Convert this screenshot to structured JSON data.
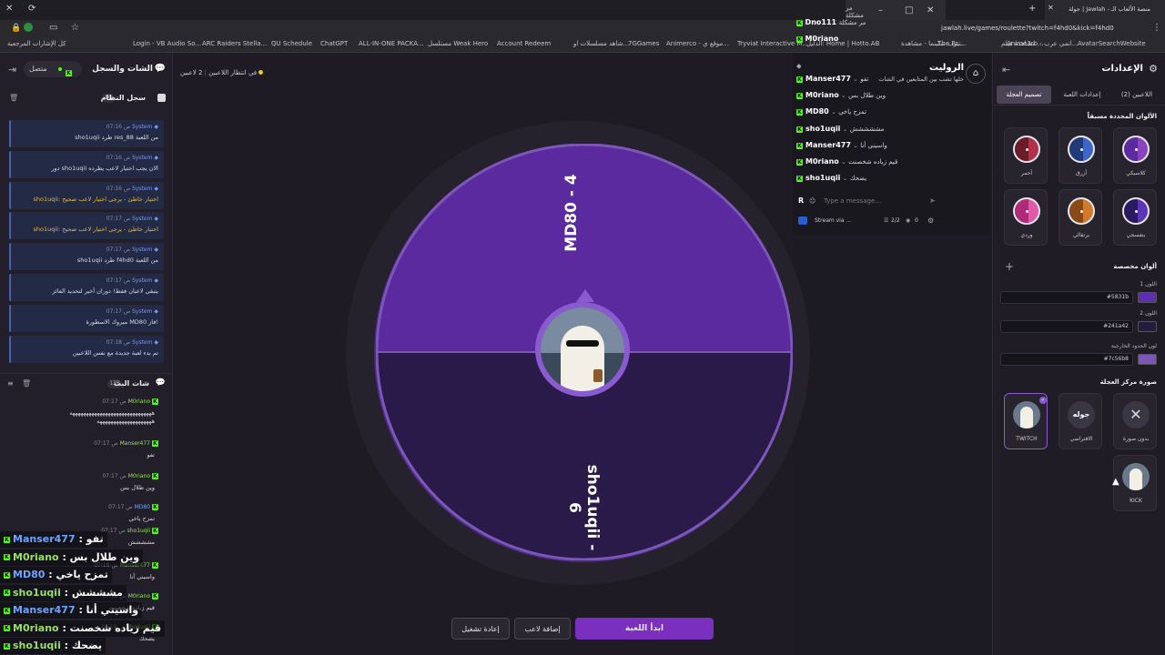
{
  "browser": {
    "tabs": [
      "مر مشكلة",
      "جولة | Jawlah - منصة الألعاب الـ"
    ],
    "url": "jawlah.live/games/roulette?twitch=f4hd0&kick=f4hd0",
    "bookmarks": [
      "كل الإشارات المرجعية",
      "Login - VB Audio So...",
      "ARC Raiders Stella...",
      "QU Schedule",
      "ChatGPT",
      "ALL-IN-ONE PACKA...",
      "مستلسل Weak Hero",
      "Account Redeem",
      "شاهد مسلسلات او...",
      "7GGames",
      "Animerco - موقع ي...",
      "Tryviat Interactive M...",
      "The Br...",
      "مشاهدة فيلم ...",
      "تيرب سلينما - مشاهدة...",
      "الدليل: Home | Hotto.AB",
      "Anime3rb - انمي عرب...",
      "AvatarSearchWebsite"
    ]
  },
  "left_panel": {
    "title": "الشات والسجل",
    "status": "متصل",
    "system_log": {
      "title": "سجل النظام",
      "count": "80",
      "entries": [
        {
          "time": "07:16 ص",
          "name": "System",
          "text": "sho1uqii طرد res_88 من اللعبة",
          "warn": false
        },
        {
          "time": "07:16 ص",
          "name": "System",
          "text": "دور sho1uqii الان يجب اختيار لاعب يطرده",
          "warn": false
        },
        {
          "time": "07:16 ص",
          "name": "System",
          "text": "sho1uqii: اختيار خاطئ - يرجى اختيار لاعب صحيح",
          "warn": true
        },
        {
          "time": "07:17 ص",
          "name": "System",
          "text": "sho1uqii: اختيار خاطئ - يرجى اختيار لاعب صحيح",
          "warn": true
        },
        {
          "time": "07:17 ص",
          "name": "System",
          "text": "sho1uqii طرد f4hd0 من اللعبة",
          "warn": false
        },
        {
          "time": "07:17 ص",
          "name": "System",
          "text": "يتبقى لاعبان فقط! دوران أخير لتحديد الفائز",
          "warn": false
        },
        {
          "time": "07:17 ص",
          "name": "System",
          "text": "مبروك الاسطورة MD80 فاز!",
          "warn": false
        },
        {
          "time": "07:18 ص",
          "name": "System",
          "text": "تم بدء لعبة جديدة مع نفس اللاعبين",
          "warn": false
        }
      ]
    },
    "stream_chat": {
      "title": "شات البث",
      "count": "133",
      "messages": [
        {
          "time": "07:17 ص",
          "name": "M0riano",
          "text": "ههههههههههههههههههههههههههههههه",
          "text2": "ههههههههههههههههههههه"
        },
        {
          "time": "07:17 ص",
          "name": "Manser477",
          "text": "تفو"
        },
        {
          "time": "07:17 ص",
          "name": "M0riano",
          "text": "وين طلال بس"
        },
        {
          "time": "07:17 ص",
          "name": "MD80",
          "text": "تمزح ياخي"
        },
        {
          "time": "07:17 ص",
          "name": "sho1uqii",
          "text": "مشششش"
        },
        {
          "time": "07:18 ص",
          "name": "Manser477",
          "text": "واسيني أنا"
        },
        {
          "time": "07:18 ص",
          "name": "M0riano",
          "text": "قيم زياده شخصنت"
        },
        {
          "time": "07:18 ص",
          "name": "sho1uqii",
          "text": "يضحك"
        }
      ]
    },
    "overlay": [
      {
        "name": "Manser477",
        "text": "تفو"
      },
      {
        "name": "M0riano",
        "text": "وين طلال بس"
      },
      {
        "name": "MD80",
        "text": "تمزح ياخي"
      },
      {
        "name": "sho1uqii",
        "text": "مشششش"
      },
      {
        "name": "Manser477",
        "text": "واسيني أنا"
      },
      {
        "name": "M0riano",
        "text": "قيم زياده شخصنت"
      },
      {
        "name": "sho1uqii",
        "text": "يضحك"
      }
    ]
  },
  "center": {
    "players_status": "2 لاعبين",
    "waiting_text": "في انتظار اللاعبين",
    "wheel": {
      "segments": [
        {
          "label": "MD80 - 4",
          "color": "#5b2a9e"
        },
        {
          "label": "sho1uqii - 6",
          "color": "#2a1a4a"
        }
      ],
      "border_color": "#7c56b8"
    },
    "buttons": {
      "start": "ابدأ اللعبة",
      "add_player": "إضافة لاعب",
      "restart": "إعادة تشغيل"
    }
  },
  "right_chat": {
    "title": "الروليت",
    "subtitle": "خلها تشب بين المتابعين في الشات",
    "top_lines": [
      {
        "name": "Dno111",
        "text": "مر مشكلة"
      },
      {
        "name": "M0riano",
        "text": ""
      }
    ],
    "lines": [
      {
        "name": "Manser477",
        "text": "تفو"
      },
      {
        "name": "M0riano",
        "text": "وين طلال بس"
      },
      {
        "name": "MD80",
        "text": "تمزح ياخي"
      },
      {
        "name": "sho1uqii",
        "text": "مششششش"
      },
      {
        "name": "Manser477",
        "text": "واسيني أنا"
      },
      {
        "name": "M0riano",
        "text": "قيم زياده شخصنت"
      },
      {
        "name": "sho1uqii",
        "text": "يضحك"
      }
    ],
    "input_placeholder": "Type a message...",
    "stream_label": "Stream via ...",
    "viewers": "2/2",
    "zero": "0"
  },
  "settings": {
    "title": "الإعدادات",
    "tabs": [
      "اللاعبين (2)",
      "إعدادات اللعبة",
      "تصميم العجلة"
    ],
    "presets_title": "الألوان المحددة مسبقاً",
    "presets": [
      {
        "label": "كلاسيكي",
        "c1": "#5b2a9e",
        "c2": "#8a43c0"
      },
      {
        "label": "أزرق",
        "c1": "#233a78",
        "c2": "#3e66c4"
      },
      {
        "label": "أحمر",
        "c1": "#6a1c28",
        "c2": "#b0324a"
      },
      {
        "label": "بنفسجي",
        "c1": "#2a1a60",
        "c2": "#5b36b8"
      },
      {
        "label": "برتقالي",
        "c1": "#8a4a18",
        "c2": "#d07a2c"
      },
      {
        "label": "وردي",
        "c1": "#b02a7a",
        "c2": "#e05aa8"
      }
    ],
    "custom_title": "ألوان مخصصة",
    "color1_label": "اللون 1",
    "color1": "#5831b",
    "color2_label": "اللون 2",
    "color2": "#241a42",
    "border_label": "لون الحدود الخارجية",
    "border_color": "#7c56b8",
    "center_image_title": "صورة مركز العجلة",
    "images": [
      {
        "label": "بدون صورة"
      },
      {
        "label": "الافتراضي",
        "text": "جوله"
      },
      {
        "label": "TWITCH"
      },
      {
        "label": "KICK"
      }
    ]
  }
}
